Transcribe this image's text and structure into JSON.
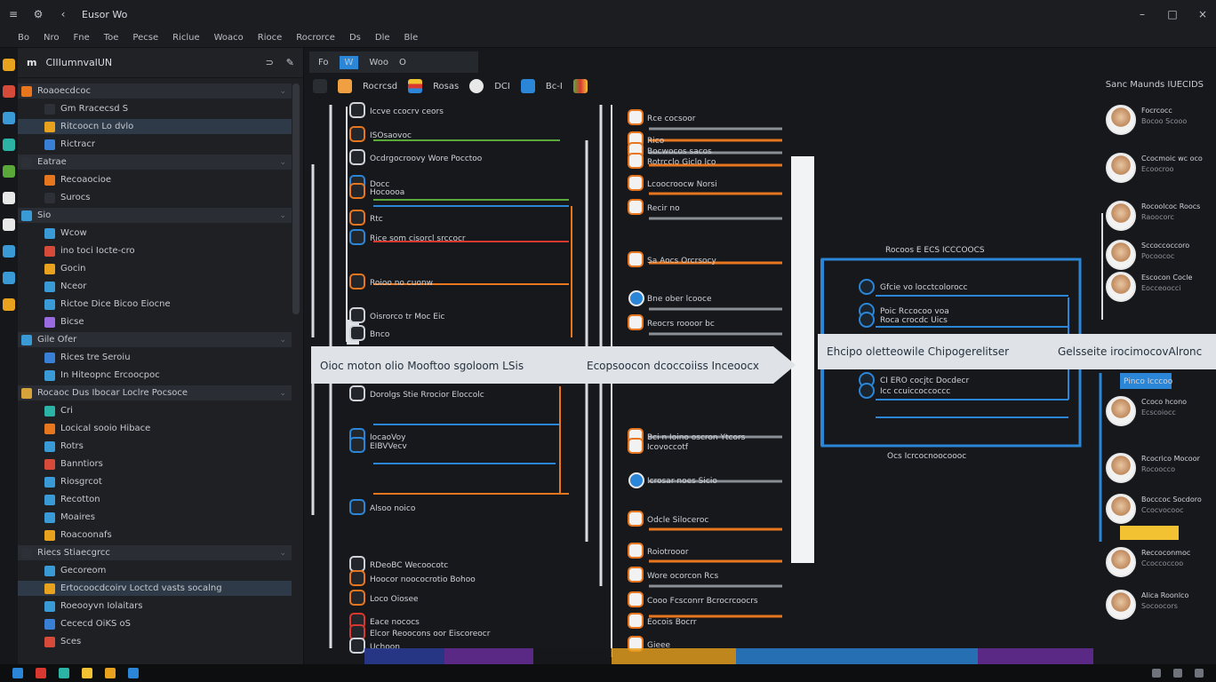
{
  "titlebar": {
    "title": "Eusor Wo"
  },
  "menu": [
    "Bo",
    "Nro",
    "Fne",
    "Toe",
    "Pecse",
    "Riclue",
    "Woaco",
    "Rioce",
    "Rocrorce",
    "Ds",
    "Dle",
    "Ble"
  ],
  "left_panel": {
    "header": "CIIIumnvalUN",
    "rows": [
      {
        "label": "Roaoecdcoc",
        "color": "#e8761e",
        "group": true
      },
      {
        "label": "Gm Rracecsd S",
        "color": "#2d3036",
        "group": false
      },
      {
        "label": "Ritcoocn Lo dvlo",
        "color": "#e8a21e",
        "group": false,
        "sel": true
      },
      {
        "label": "Rictracr",
        "color": "#3a7fd6",
        "group": false
      },
      {
        "label": "Eatrae",
        "color": "#2d3036",
        "group": true
      },
      {
        "label": "Recoaocioe",
        "color": "#e8761e",
        "group": false
      },
      {
        "label": "Surocs",
        "color": "#2d3036",
        "group": false
      },
      {
        "label": "Sio",
        "color": "#3a9ad6",
        "group": true
      },
      {
        "label": "Wcow",
        "color": "#3a9ad6",
        "group": false
      },
      {
        "label": "ino toci Iocte-cro",
        "color": "#d64a3a",
        "group": false
      },
      {
        "label": "Gocin",
        "color": "#e8a21e",
        "group": false
      },
      {
        "label": "Nceor",
        "color": "#3a9ad6",
        "group": false
      },
      {
        "label": "Rictoe Dice Bicoo Eiocne",
        "color": "#3a9ad6",
        "group": false
      },
      {
        "label": "Bicse",
        "color": "#9a6ae0",
        "group": false
      },
      {
        "label": "Gile Ofer",
        "color": "#3a9ad6",
        "group": true
      },
      {
        "label": "Rices tre Seroiu",
        "color": "#3a7fd6",
        "group": false
      },
      {
        "label": "In Hiteopnc Ercoocpoc",
        "color": "#3a9ad6",
        "group": false
      },
      {
        "label": "Rocaoc Dus Ibocar Loclre Pocsoce",
        "color": "#d6a23a",
        "group": true
      },
      {
        "label": "Cri",
        "color": "#2bb3a6",
        "group": false
      },
      {
        "label": "Locical sooio Hibace",
        "color": "#e8761e",
        "group": false
      },
      {
        "label": "Rotrs",
        "color": "#3a9ad6",
        "group": false
      },
      {
        "label": "Banntiors",
        "color": "#d64a3a",
        "group": false
      },
      {
        "label": "Riosgrcot",
        "color": "#3a9ad6",
        "group": false
      },
      {
        "label": "Recotton",
        "color": "#3a9ad6",
        "group": false
      },
      {
        "label": "Moaires",
        "color": "#3a9ad6",
        "group": false
      },
      {
        "label": "Roacoonafs",
        "color": "#e8a21e",
        "group": false
      },
      {
        "label": "Riecs Stiaecgrcc",
        "color": "#2d3036",
        "group": true
      },
      {
        "label": "Gecoreom",
        "color": "#3a9ad6",
        "group": false
      },
      {
        "label": "Ertocoocdcoirv Loctcd vasts socalng",
        "color": "#e8a21e",
        "group": false,
        "sel": true
      },
      {
        "label": "Roeooyvn Iolaitars",
        "color": "#3a9ad6",
        "group": false
      },
      {
        "label": "Cececd OiKS oS",
        "color": "#3a7fd6",
        "group": false
      },
      {
        "label": "Sces",
        "color": "#d64a3a",
        "group": false
      }
    ]
  },
  "canvas": {
    "tabs": [
      "Fo",
      "W",
      "Woo",
      "O"
    ],
    "toolbar": [
      "Rocrcsd",
      "Rosas",
      "DCI",
      "Bc-I"
    ],
    "toolbar_right": "Sanc  Maunds  IUECIDS"
  },
  "diagram": {
    "col1_labels": [
      "Iccve ccocrv ceors",
      "ISOsaovoc",
      "Ocdrgocroovy Wore Pocctoo",
      "Docc",
      "Hocoooa",
      "Rtc",
      "Rice som cisorcl srccocr",
      "Roioo no cuonw",
      "Oisrorco tr Moc Eic",
      "Bnco",
      "Dorolgs Stie Rrocior Eloccolc",
      "IocaoVoy",
      "EIBVVecv",
      "Alsoo noico",
      "RDeoBC Wecoocotc",
      "Hoocor noococrotio Bohoo",
      "Loco Oiosee",
      "Eace nococs",
      "Elcor Reoocons oor Eiscoreocr",
      "Uchoon"
    ],
    "col2_labels": [
      "Rce cocsoor",
      "Rico",
      "Bocwocos sacos",
      "Rotrcclo Giclo lco",
      "Lcoocroocw Norsi",
      "Recir no",
      "Sa Aocs Orcrsocy",
      "Bne ober lcooce",
      "Reocrs roooor bc",
      "Bci n Ioino oscron Ytcors",
      "Icovoccotf",
      "Icrosar noes Sicio",
      "Odcle Siloceroc",
      "Roiotrooor",
      "Wore ocorcon Rcs",
      "Cooo Fcsconrr Bcrocrcoocrs",
      "Eocois Bocrr",
      "Gieee"
    ],
    "group_title": "Rocoos E ECS ICCCOOCS",
    "group_items": [
      "Gfcie vo locctcolorocc",
      "Poic Rccocoo voa",
      "Roca crocdc Uics",
      "CI ERO cocjtc Docdecr",
      "Icc ccuiccoccoccc"
    ],
    "group_footer": "Ocs Icrcocnoocoooc",
    "banner_left": "Oioc moton olio Mooftoo sgoloom LSis",
    "banner_mid": "Ecopsoocon dcoccoiiss Inceoocx",
    "banner_right": "Ehcipo oletteowile Chipogerelitser",
    "banner_far": "Gelsseite irocimocovAlronc",
    "badge": "Pinco Icccoo"
  },
  "people": [
    {
      "name": "Focrcocc",
      "sub": "Bocoo Scooo"
    },
    {
      "name": "Ccocmoic wc oco",
      "sub": "Ecoocroo"
    },
    {
      "name": "Rocoolcoc Roocs",
      "sub": "Raoocorc"
    },
    {
      "name": "Sccoccoccoro",
      "sub": "Pocoococ"
    },
    {
      "name": "Escocon Cocle",
      "sub": "Eocceoocci"
    },
    {
      "name": "Ccoco hcono",
      "sub": "Ecscoiocc"
    },
    {
      "name": "Rcocrico Mocoor",
      "sub": "Rocoocco"
    },
    {
      "name": "Bocccoc Socdoro",
      "sub": "Ccocvocooc"
    },
    {
      "name": "Reccoconmoc",
      "sub": "Ccoccoccoo"
    },
    {
      "name": "Alica Roonlco",
      "sub": "Socoocors"
    }
  ],
  "colors": {
    "accent_blue": "#2b86d8",
    "accent_orange": "#e8761e",
    "accent_red": "#d8382f",
    "accent_green": "#5aa83a",
    "banner": "#dfe3e8"
  }
}
